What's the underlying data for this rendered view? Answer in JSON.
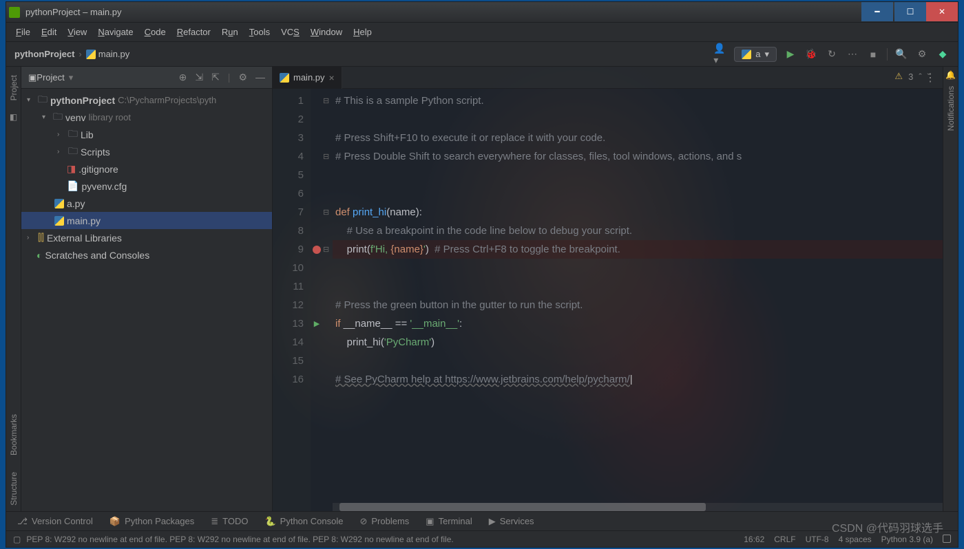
{
  "title": "pythonProject – main.py",
  "menu": [
    "File",
    "Edit",
    "View",
    "Navigate",
    "Code",
    "Refactor",
    "Run",
    "Tools",
    "VCS",
    "Window",
    "Help"
  ],
  "breadcrumb": {
    "project": "pythonProject",
    "file": "main.py"
  },
  "runConfig": "a",
  "projectPanel": {
    "title": "Project",
    "tree": {
      "root": "pythonProject",
      "rootPath": "C:\\PycharmProjects\\pyth",
      "venv": "venv",
      "venvHint": "library root",
      "lib": "Lib",
      "scripts": "Scripts",
      "gitignore": ".gitignore",
      "pyvenv": "pyvenv.cfg",
      "apy": "a.py",
      "mainpy": "main.py",
      "ext": "External Libraries",
      "scratch": "Scratches and Consoles"
    }
  },
  "tab": "main.py",
  "warnCount": "3",
  "code": {
    "l1": "# This is a sample Python script.",
    "l3": "# Press Shift+F10 to execute it or replace it with your code.",
    "l4": "# Press Double Shift to search everywhere for classes, files, tool windows, actions, and s",
    "l7def": "def ",
    "l7fn": "print_hi",
    "l7rest": "(name):",
    "l8": "    # Use a breakpoint in the code line below to debug your script.",
    "l9a": "    print(",
    "l9b": "f'Hi, ",
    "l9c": "{name}",
    "l9d": "'",
    "l9e": ")  ",
    "l9f": "# Press Ctrl+F8 to toggle the breakpoint.",
    "l12": "# Press the green button in the gutter to run the script.",
    "l13a": "if ",
    "l13b": "__name__ == ",
    "l13c": "'__main__'",
    "l13d": ":",
    "l14a": "    print_hi(",
    "l14b": "'PyCharm'",
    "l14c": ")",
    "l16": "# See PyCharm help at https://www.jetbrains.com/help/pycharm/"
  },
  "bottomTabs": {
    "vcs": "Version Control",
    "pkg": "Python Packages",
    "todo": "TODO",
    "console": "Python Console",
    "problems": "Problems",
    "terminal": "Terminal",
    "services": "Services"
  },
  "status": {
    "msg": "PEP 8: W292 no newline at end of file. PEP 8: W292 no newline at end of file. PEP 8: W292 no newline at end of file.",
    "pos": "16:62",
    "sep": "CRLF",
    "enc": "UTF-8",
    "indent": "4 spaces",
    "python": "Python 3.9 (a)"
  },
  "leftGutter": {
    "project": "Project",
    "bookmarks": "Bookmarks",
    "structure": "Structure"
  },
  "rightGutter": {
    "notifications": "Notifications"
  },
  "watermark": "CSDN @代码羽球选手"
}
